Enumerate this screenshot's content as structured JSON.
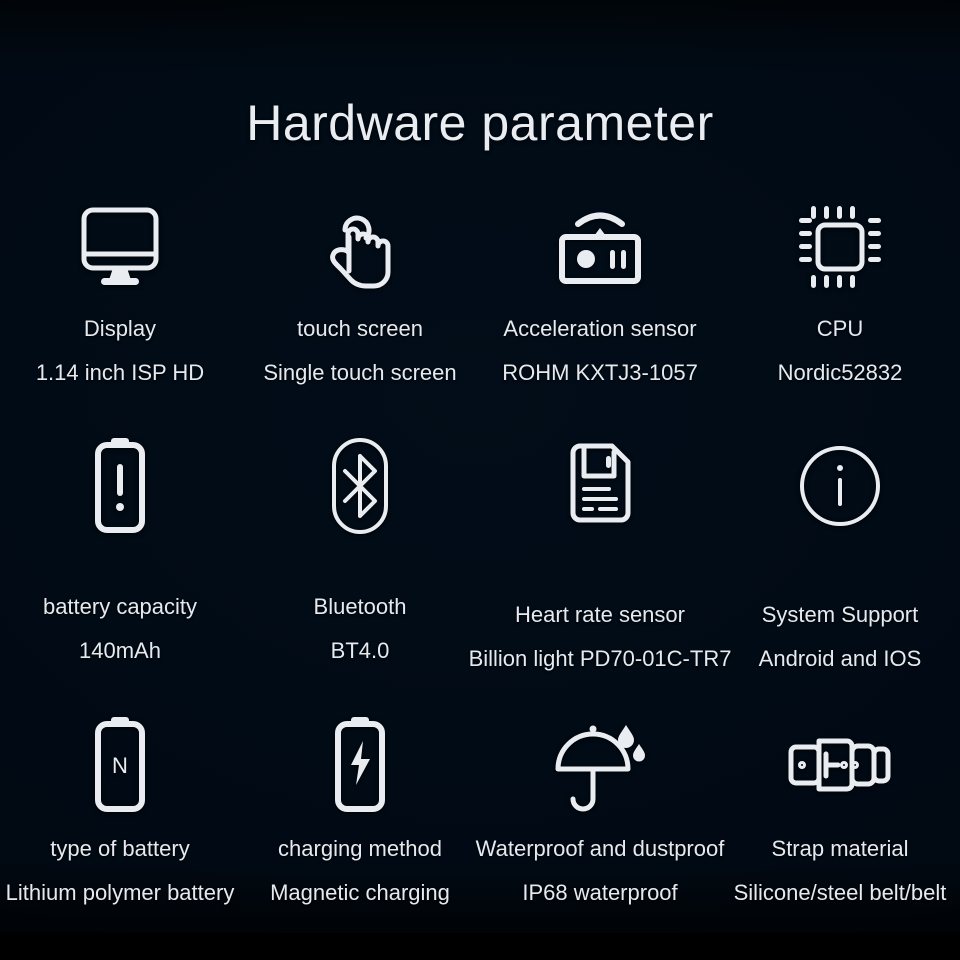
{
  "page": {
    "title": "Hardware parameter",
    "background_color": "#010a14",
    "outer_color": "#000000",
    "text_color": "#e6eaef"
  },
  "rows": [
    {
      "items": [
        {
          "icon": "monitor-display-icon",
          "label": "Display",
          "value": "1.14 inch ISP HD"
        },
        {
          "icon": "touch-hand-icon",
          "label": "touch screen",
          "value": "Single touch screen"
        },
        {
          "icon": "acceleration-sensor-icon",
          "label": "Acceleration sensor",
          "value": "ROHM KXTJ3-1057"
        },
        {
          "icon": "cpu-chip-icon",
          "label": "CPU",
          "value": "Nordic52832"
        }
      ]
    },
    {
      "items": [
        {
          "icon": "battery-alert-icon",
          "label": "battery capacity",
          "value": "140mAh"
        },
        {
          "icon": "bluetooth-icon",
          "label": "Bluetooth",
          "value": "BT4.0"
        },
        {
          "icon": "document-sensor-icon",
          "label": "Heart rate sensor",
          "value": "Billion light PD70-01C-TR7"
        },
        {
          "icon": "info-circle-icon",
          "label": "System Support",
          "value": "Android and IOS"
        }
      ]
    },
    {
      "items": [
        {
          "icon": "battery-type-icon",
          "label": "type of battery",
          "value": "Lithium polymer battery"
        },
        {
          "icon": "battery-charging-icon",
          "label": "charging method",
          "value": "Magnetic charging"
        },
        {
          "icon": "umbrella-rain-icon",
          "label": "Waterproof and dustproof",
          "value": "IP68 waterproof"
        },
        {
          "icon": "watch-strap-icon",
          "label": "Strap material",
          "value": "Silicone/steel belt/belt"
        }
      ]
    }
  ]
}
